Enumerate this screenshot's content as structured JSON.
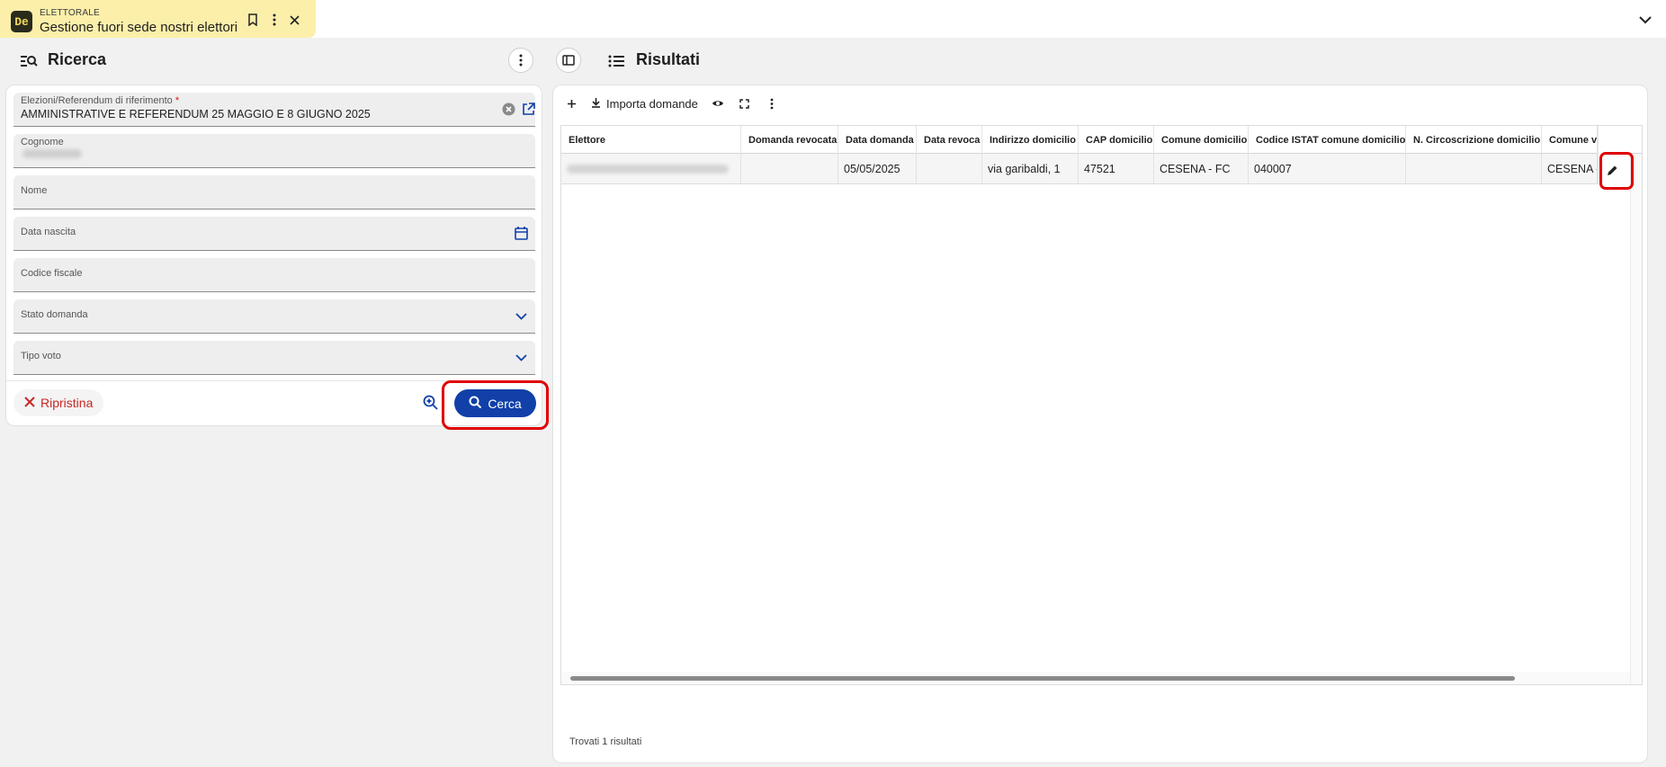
{
  "tab": {
    "logo_text": "De",
    "module": "ELETTORALE",
    "title": "Gestione fuori sede nostri elettori"
  },
  "search_panel": {
    "title": "Ricerca",
    "fields": {
      "election": {
        "label": "Elezioni/Referendum di riferimento",
        "required_mark": "*",
        "value": "AMMINISTRATIVE E REFERENDUM 25 MAGGIO E 8 GIUGNO 2025"
      },
      "surname": {
        "label": "Cognome"
      },
      "name": {
        "label": "Nome"
      },
      "birth_date": {
        "label": "Data nascita"
      },
      "tax_code": {
        "label": "Codice fiscale"
      },
      "status": {
        "label": "Stato domanda"
      },
      "vote_type": {
        "label": "Tipo voto"
      }
    },
    "reset_label": "Ripristina",
    "search_label": "Cerca"
  },
  "results_panel": {
    "title": "Risultati",
    "import_label": "Importa domande",
    "columns": [
      "Elettore",
      "Domanda revocata",
      "Data domanda",
      "Data revoca",
      "Indirizzo domicilio",
      "CAP domicilio",
      "Comune domicilio",
      "Codice ISTAT comune domicilio",
      "N. Circoscrizione domicilio",
      "Comune v"
    ],
    "rows": [
      {
        "domanda_revocata": "",
        "data_domanda": "05/05/2025",
        "data_revoca": "",
        "indirizzo": "via garibaldi, 1",
        "cap": "47521",
        "comune": "CESENA - FC",
        "istat": "040007",
        "circoscrizione": "",
        "comune_v": "CESENA -"
      }
    ],
    "footer": "Trovati 1 risultati"
  },
  "colors": {
    "tab_bg": "#fbefaa",
    "primary": "#1040a8",
    "danger": "#c62828",
    "highlight": "#e00000"
  }
}
